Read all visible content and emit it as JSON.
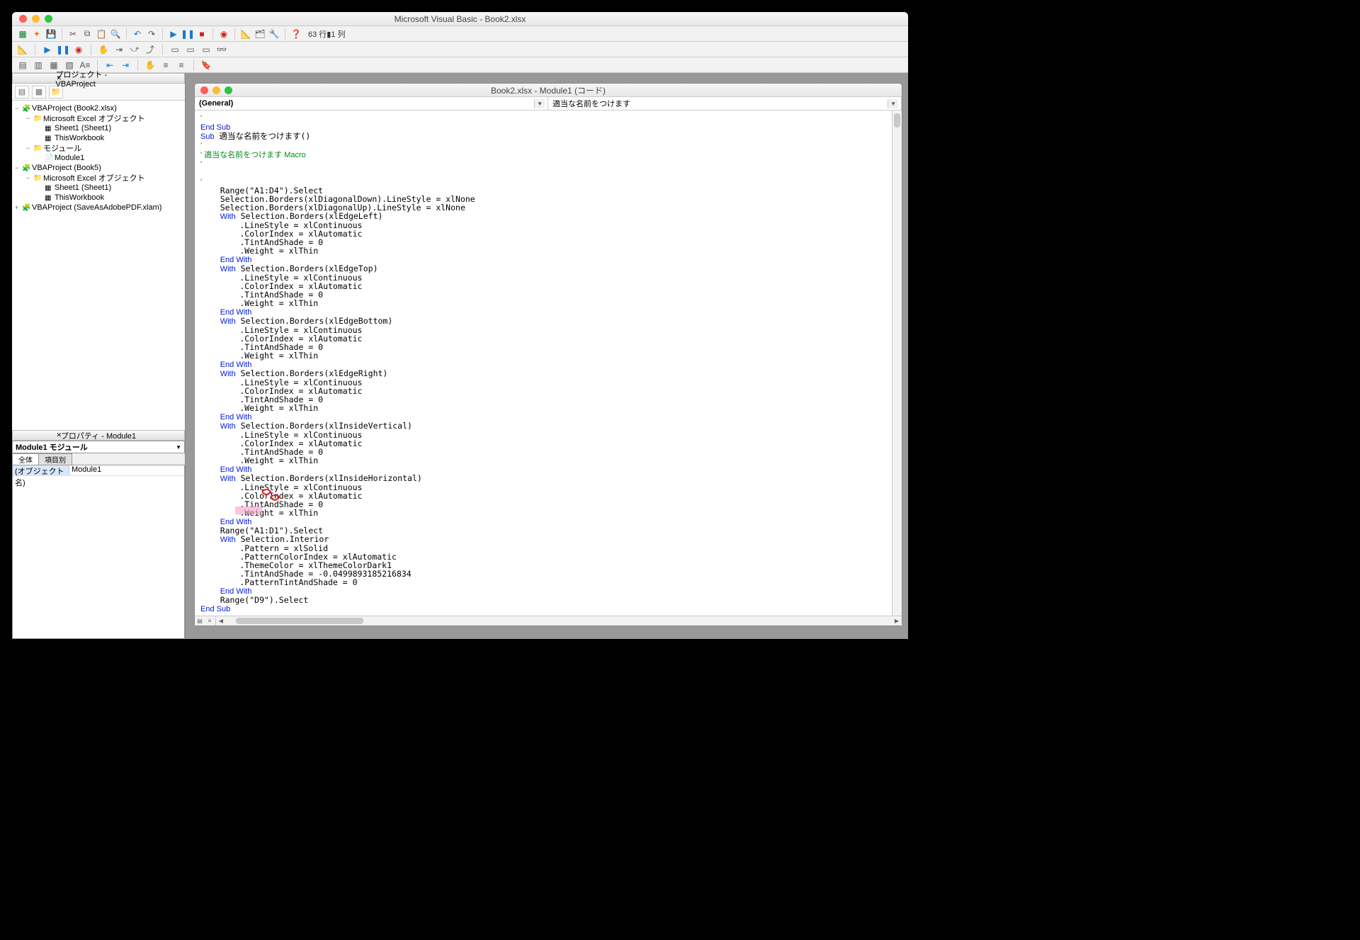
{
  "window": {
    "title": "Microsoft Visual Basic - Book2.xlsx"
  },
  "cursor_position": "63 行▮1 列",
  "project_pane": {
    "title": "プロジェクト - VBAProject",
    "tree": [
      {
        "indent": 0,
        "toggle": "−",
        "icon": "vba",
        "label": "VBAProject (Book2.xlsx)"
      },
      {
        "indent": 1,
        "toggle": "−",
        "icon": "folder",
        "label": "Microsoft Excel オブジェクト"
      },
      {
        "indent": 2,
        "toggle": "",
        "icon": "sheet",
        "label": "Sheet1 (Sheet1)"
      },
      {
        "indent": 2,
        "toggle": "",
        "icon": "sheet",
        "label": "ThisWorkbook"
      },
      {
        "indent": 1,
        "toggle": "−",
        "icon": "folder",
        "label": "モジュール"
      },
      {
        "indent": 2,
        "toggle": "",
        "icon": "module",
        "label": "Module1"
      },
      {
        "indent": 0,
        "toggle": "−",
        "icon": "vba",
        "label": "VBAProject (Book5)"
      },
      {
        "indent": 1,
        "toggle": "−",
        "icon": "folder",
        "label": "Microsoft Excel オブジェクト"
      },
      {
        "indent": 2,
        "toggle": "",
        "icon": "sheet",
        "label": "Sheet1 (Sheet1)"
      },
      {
        "indent": 2,
        "toggle": "",
        "icon": "sheet",
        "label": "ThisWorkbook"
      },
      {
        "indent": 0,
        "toggle": "+",
        "icon": "vba",
        "label": "VBAProject (SaveAsAdobePDF.xlam)"
      }
    ]
  },
  "properties_pane": {
    "title": "プロパティ - Module1",
    "header": "Module1  モジュール",
    "tabs": {
      "all": "全体",
      "by_item": "項目別"
    },
    "rows": [
      {
        "key": "(オブジェクト名)",
        "value": "Module1"
      }
    ]
  },
  "code_window": {
    "title": "Book2.xlsx - Module1 (コード)",
    "left_dd": "(General)",
    "right_dd": "適当な名前をつけます",
    "code_lines": [
      {
        "t": "'",
        "c": "cm"
      },
      {
        "t": "End Sub",
        "c": "kw"
      },
      {
        "t": "<kw>Sub</kw> 適当な名前をつけます()"
      },
      {
        "t": "'",
        "c": "cm"
      },
      {
        "t": "' 適当な名前をつけます Macro",
        "c": "cm"
      },
      {
        "t": "'",
        "c": "cm"
      },
      {
        "t": ""
      },
      {
        "t": "'",
        "c": "cm"
      },
      {
        "t": "    Range(\"A1:D4\").Select"
      },
      {
        "t": "    Selection.Borders(xlDiagonalDown).LineStyle = xlNone"
      },
      {
        "t": "    Selection.Borders(xlDiagonalUp).LineStyle = xlNone"
      },
      {
        "t": "    <kw>With</kw> Selection.Borders(xlEdgeLeft)"
      },
      {
        "t": "        .LineStyle = xlContinuous"
      },
      {
        "t": "        .ColorIndex = xlAutomatic"
      },
      {
        "t": "        .TintAndShade = 0"
      },
      {
        "t": "        .Weight = xlThin"
      },
      {
        "t": "    <kw>End With</kw>"
      },
      {
        "t": "    <kw>With</kw> Selection.Borders(xlEdgeTop)"
      },
      {
        "t": "        .LineStyle = xlContinuous"
      },
      {
        "t": "        .ColorIndex = xlAutomatic"
      },
      {
        "t": "        .TintAndShade = 0"
      },
      {
        "t": "        .Weight = xlThin"
      },
      {
        "t": "    <kw>End With</kw>"
      },
      {
        "t": "    <kw>With</kw> Selection.Borders(xlEdgeBottom)"
      },
      {
        "t": "        .LineStyle = xlContinuous"
      },
      {
        "t": "        .ColorIndex = xlAutomatic"
      },
      {
        "t": "        .TintAndShade = 0"
      },
      {
        "t": "        .Weight = xlThin"
      },
      {
        "t": "    <kw>End With</kw>"
      },
      {
        "t": "    <kw>With</kw> Selection.Borders(xlEdgeRight)"
      },
      {
        "t": "        .LineStyle = xlContinuous"
      },
      {
        "t": "        .ColorIndex = xlAutomatic"
      },
      {
        "t": "        .TintAndShade = 0"
      },
      {
        "t": "        .Weight = xlThin"
      },
      {
        "t": "    <kw>End With</kw>"
      },
      {
        "t": "    <kw>With</kw> Selection.Borders(xlInsideVertical)"
      },
      {
        "t": "        .LineStyle = xlContinuous"
      },
      {
        "t": "        .ColorIndex = xlAutomatic"
      },
      {
        "t": "        .TintAndShade = 0"
      },
      {
        "t": "        .Weight = xlThin"
      },
      {
        "t": "    <kw>End With</kw>"
      },
      {
        "t": "    <kw>With</kw> Selection.Borders(xlInsideHorizontal)"
      },
      {
        "t": "        .LineStyle = xlContinuous"
      },
      {
        "t": "        .ColorIndex = xlAutomatic"
      },
      {
        "t": "        .TintAndShade = 0"
      },
      {
        "t": "        .Weight = xlThin"
      },
      {
        "t": "    <kw>End With</kw>"
      },
      {
        "t": "    Range(\"A1:D1\").Select"
      },
      {
        "t": "    <kw>With</kw> Selection.Interior"
      },
      {
        "t": "        .Pattern = xlSolid"
      },
      {
        "t": "        .PatternColorIndex = xlAutomatic"
      },
      {
        "t": "        .ThemeColor = xlThemeColorDark1"
      },
      {
        "t": "        .TintAndShade = -0.0499893185216834"
      },
      {
        "t": "        .PatternTintAndShade = 0"
      },
      {
        "t": "    <kw>End With</kw>"
      },
      {
        "t": "    Range(\"D9\").Select"
      },
      {
        "t": "<kw>End Sub</kw>"
      }
    ]
  }
}
